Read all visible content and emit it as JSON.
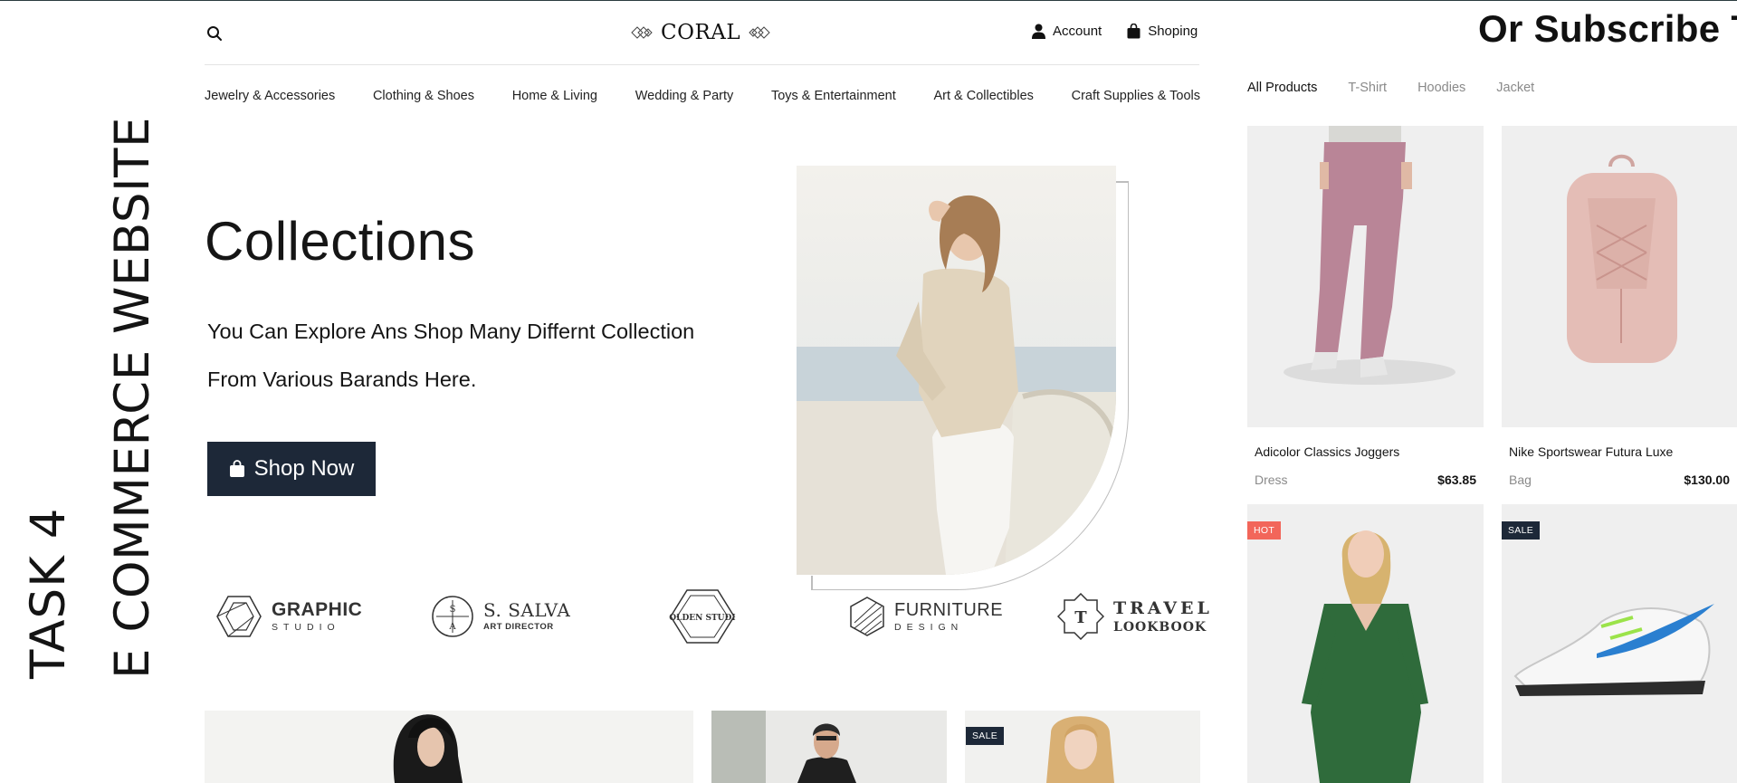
{
  "side_titles": {
    "task": "TASK 4",
    "project": "E COMMERCE WEBSITE"
  },
  "header": {
    "logo": "CORAL",
    "account_label": "Account",
    "shopping_label": "Shoping"
  },
  "categories": [
    "Jewelry & Accessories",
    "Clothing & Shoes",
    "Home & Living",
    "Wedding & Party",
    "Toys & Entertainment",
    "Art & Collectibles",
    "Craft Supplies & Tools"
  ],
  "hero": {
    "title": "Collections",
    "subtitle_line1": "You Can Explore Ans Shop Many Differnt Collection",
    "subtitle_line2": "From Various Barands Here.",
    "cta": "Shop Now"
  },
  "brands": [
    {
      "name": "GRAPHIC",
      "tag": "STUDIO"
    },
    {
      "name": "S. SALVA",
      "tag": "ART DIRECTOR"
    },
    {
      "name": "GOLDEN STUDIO",
      "tag": ""
    },
    {
      "name": "FURNITURE",
      "tag": "DESIGN"
    },
    {
      "name": "TRAVEL",
      "tag": "LOOKBOOK"
    }
  ],
  "bottom_grid": {
    "sale_badge": "SALE"
  },
  "right_panel": {
    "subscribe_heading": "Or Subscribe To",
    "tabs": [
      "All Products",
      "T-Shirt",
      "Hoodies",
      "Jacket"
    ],
    "products": [
      {
        "name": "Adicolor Classics Joggers",
        "category": "Dress",
        "price": "$63.85"
      },
      {
        "name": "Nike Sportswear Futura Luxe",
        "category": "Bag",
        "price": "$130.00"
      }
    ],
    "badges": {
      "hot": "HOT",
      "sale": "SALE"
    }
  },
  "colors": {
    "primary_dark": "#1d2838",
    "hot_badge": "#f2665a",
    "sale_badge": "#1d2838",
    "muted_text": "#8a8a8a"
  },
  "icons": [
    "search-icon",
    "user-icon",
    "shopping-bag-icon",
    "logo-diamond-icon"
  ]
}
